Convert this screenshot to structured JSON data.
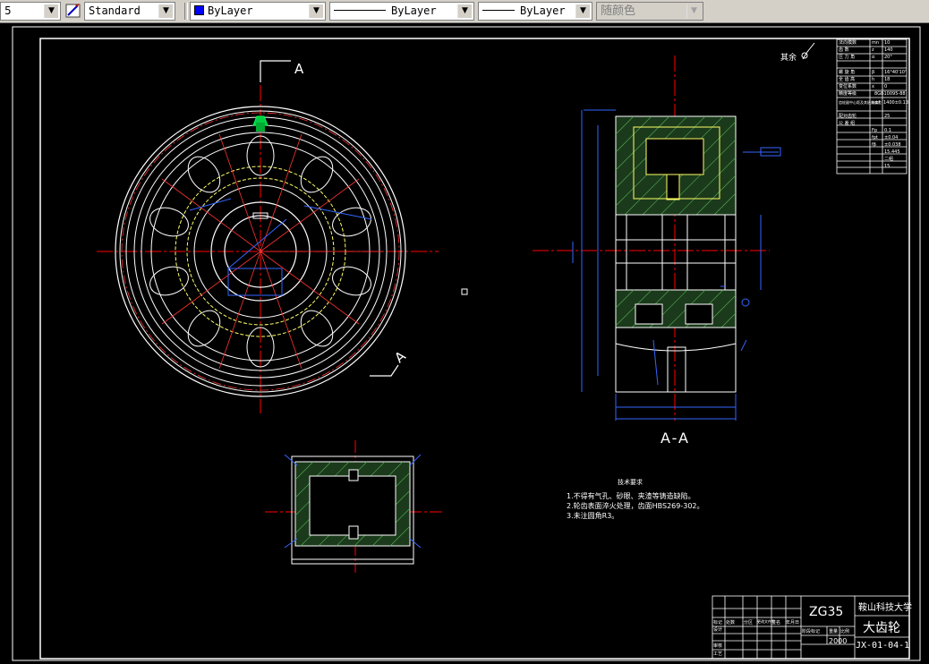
{
  "toolbar": {
    "style_combo_value": "5",
    "text_style_value": "Standard",
    "layer_color_value": "ByLayer",
    "linetype_value": "ByLayer",
    "lineweight_value": "ByLayer",
    "plot_style_value": "随颜色"
  },
  "drawing": {
    "section_label_top": "A",
    "section_label_bottom": "A",
    "section_view_label": "A-A",
    "roughness_note": "其余",
    "tech_requirements_title": "技术要求",
    "tech_requirements": [
      "1.不得有气孔、砂眼、夹渣等铸造缺陷。",
      "2.轮齿表面淬火处理，齿面HBS269-302。",
      "3.未注圆角R3。"
    ]
  },
  "title_block": {
    "material": "ZG35",
    "school": "鞍山科技大学",
    "part_name": "大齿轮",
    "drawing_number": "JX-01-04-1",
    "scale": "2000",
    "rows_left": [
      "标记",
      "设计",
      "",
      "审核",
      "工艺"
    ],
    "cols": [
      "处数",
      "分区",
      "更改文件号",
      "签名",
      "年月日"
    ],
    "stage_label": "阶段标记",
    "weight_label": "重量",
    "scale_label": "比例"
  },
  "param_table": {
    "rows": [
      {
        "name": "法向模数",
        "sym": "mn",
        "val": "10"
      },
      {
        "name": "齿    数",
        "sym": "z",
        "val": "140"
      },
      {
        "name": "压 力 角",
        "sym": "α",
        "val": "20°"
      },
      {
        "name": "",
        "sym": "",
        "val": ""
      },
      {
        "name": "螺 旋 角",
        "sym": "β",
        "val": "16°40'10\""
      },
      {
        "name": "全 齿 高",
        "sym": "h",
        "val": "18"
      },
      {
        "name": "变位系数",
        "sym": "x",
        "val": "0"
      },
      {
        "name": "精度等级",
        "sym": "",
        "val": "8GB10095-88"
      },
      {
        "name": "齿轮副中心距及其极限偏差",
        "sym": "a±f",
        "val": "1400±0.13"
      },
      {
        "name": "配对齿轮",
        "sym": "",
        "val": "25"
      },
      {
        "name": "公 差 组",
        "sym": "",
        "val": ""
      },
      {
        "name": "",
        "sym": "Fp",
        "val": "0.1"
      },
      {
        "name": "",
        "sym": "fpt",
        "val": "±0.04"
      },
      {
        "name": "",
        "sym": "fβ",
        "val": "±0.038"
      },
      {
        "name": "",
        "sym": "",
        "val": "15.445"
      },
      {
        "name": "",
        "sym": "",
        "val": "二组"
      },
      {
        "name": "",
        "sym": "",
        "val": "15"
      }
    ]
  }
}
